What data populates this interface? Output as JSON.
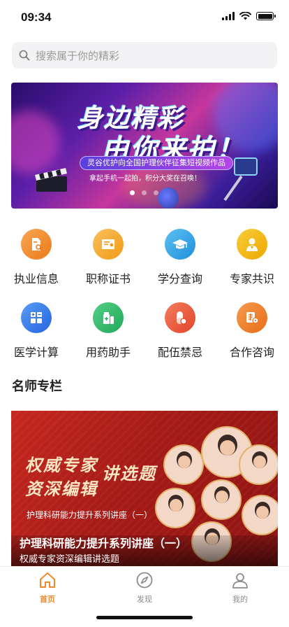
{
  "status_bar": {
    "time": "09:34"
  },
  "search": {
    "placeholder": "搜索属于你的精彩"
  },
  "banner": {
    "title_line1": "身边精彩",
    "title_line2": "由你来拍！",
    "pill": "灵谷优护向全国护理伙伴征集短视频作品",
    "subtitle": "拿起手机一起拍，积分大奖在召唤！",
    "dots": 3,
    "active_dot": 0
  },
  "features": [
    {
      "label": "执业信息",
      "icon": "id-document-icon",
      "color": "#f08a2b"
    },
    {
      "label": "职称证书",
      "icon": "certificate-icon",
      "color": "#f5a623"
    },
    {
      "label": "学分查询",
      "icon": "graduation-cap-icon",
      "color": "#2fa3e6"
    },
    {
      "label": "专家共识",
      "icon": "doctor-icon",
      "color": "#f2b400"
    },
    {
      "label": "医学计算",
      "icon": "calculator-icon",
      "color": "#2f7bea"
    },
    {
      "label": "用药助手",
      "icon": "medicine-bottle-icon",
      "color": "#31b86a"
    },
    {
      "label": "配伍禁忌",
      "icon": "pill-icon",
      "color": "#ee5a3c"
    },
    {
      "label": "合作咨询",
      "icon": "cooperation-icon",
      "color": "#ef7a26"
    }
  ],
  "section": {
    "title": "名师专栏"
  },
  "course": {
    "banner_line1": "权威专家",
    "banner_line2": "资深编辑",
    "banner_line3": "讲选题",
    "banner_small": "护理科研能力提升系列讲座（一）",
    "title": "护理科研能力提升系列讲座（一）",
    "subtitle": "权威专家资深编辑讲选题"
  },
  "tabbar": {
    "items": [
      {
        "label": "首页",
        "icon": "home-icon",
        "active": true
      },
      {
        "label": "发现",
        "icon": "compass-icon",
        "active": false
      },
      {
        "label": "我的",
        "icon": "profile-icon",
        "active": false
      }
    ],
    "active_color": "#f08a2b",
    "inactive_color": "#8a8a8a"
  }
}
